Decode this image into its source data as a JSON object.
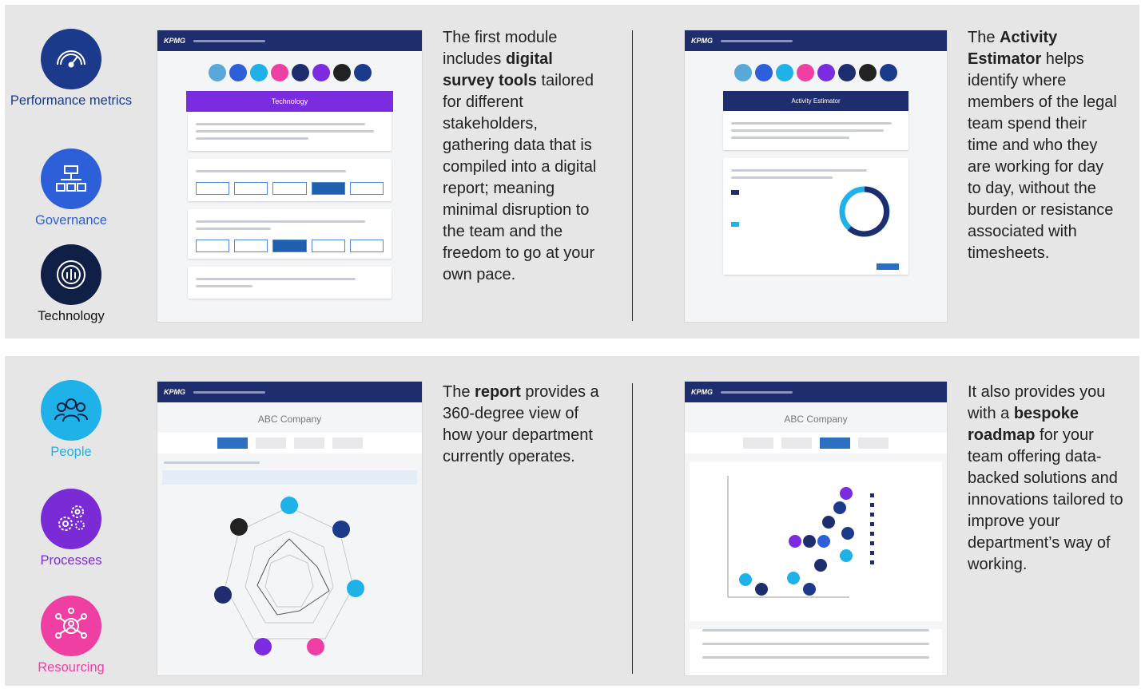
{
  "categories_top": [
    {
      "label": "Performance metrics",
      "icon": "speedometer-icon",
      "color": "#1b3a8c"
    },
    {
      "label": "Governance",
      "icon": "org-chart-icon",
      "color": "#2d5fd8"
    },
    {
      "label": "Technology",
      "icon": "tech-gear-icon",
      "color": "#0f1f45"
    }
  ],
  "categories_bottom": [
    {
      "label": "People",
      "icon": "people-icon",
      "color": "#1fb2e8"
    },
    {
      "label": "Processes",
      "icon": "gears-icon",
      "color": "#7a2bd6"
    },
    {
      "label": "Resourcing",
      "icon": "network-person-icon",
      "color": "#ef3fa3"
    }
  ],
  "colors": {
    "accent_navy": "#1e2d6e",
    "panel_bg": "#e6e6e6",
    "technology_banner": "#7b2be0",
    "activity_banner": "#1e2d6e"
  },
  "shots": {
    "survey": {
      "logo": "KPMG",
      "banner": "Technology"
    },
    "activity": {
      "logo": "KPMG",
      "banner": "Activity Estimator"
    },
    "report": {
      "logo": "KPMG",
      "company": "ABC Company"
    },
    "roadmap": {
      "logo": "KPMG",
      "company": "ABC Company"
    }
  },
  "blurbs": {
    "survey": {
      "t1": "The first module includes ",
      "b1": "digital survey tools",
      "t2": " tailored for different stakeholders, gathering data that is compiled into a digital report; meaning minimal disruption to the team and the freedom to go at your own pace."
    },
    "activity": {
      "t1": "The ",
      "b1": "Activity Estimator",
      "t2": " helps identify where members of the legal team spend their time and who they are working for day to day, without the burden or resistance associated with timesheets."
    },
    "report": {
      "t1": "The ",
      "b1": "report",
      "t2": " provides a 360-degree view of how your department currently operates."
    },
    "roadmap": {
      "t1": "It also provides you with a ",
      "b1": "bespoke roadmap",
      "t2": " for your team offering data-backed solutions and innovations tailored to improve your department’s way of working."
    }
  }
}
